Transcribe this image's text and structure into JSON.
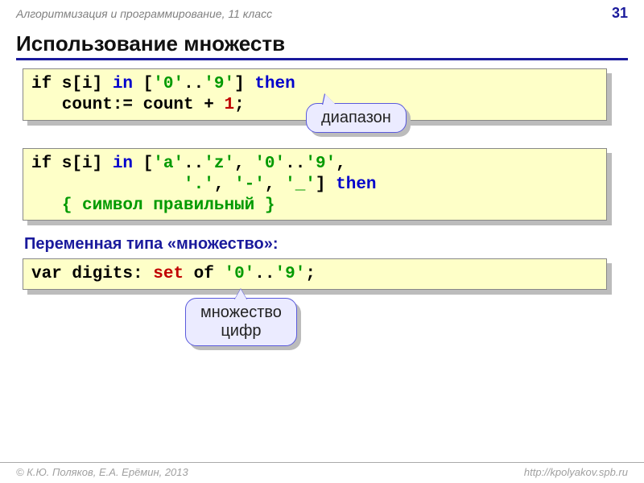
{
  "header": {
    "breadcrumb": "Алгоритмизация и программирование, 11 класс",
    "page": "31"
  },
  "title": "Использование множеств",
  "code1": {
    "l1_a": "if s[i] ",
    "l1_in": "in",
    "l1_b": " [",
    "l1_lit1": "'0'",
    "l1_c": "..",
    "l1_lit2": "'9'",
    "l1_d": "] ",
    "l1_then": "then",
    "l2_a": "   count:= count + ",
    "l2_one": "1",
    "l2_b": ";"
  },
  "callout1": "диапазон",
  "code2": {
    "l1_a": "if s[i] ",
    "l1_in": "in",
    "l1_b": " [",
    "l1_lit1": "'a'",
    "l1_c": "..",
    "l1_lit2": "'z'",
    "l1_d": ", ",
    "l1_lit3": "'0'",
    "l1_e": "..",
    "l1_lit4": "'9'",
    "l1_f": ",",
    "l2_pad": "               ",
    "l2_lit1": "'.'",
    "l2_a": ", ",
    "l2_lit2": "'-'",
    "l2_b": ", ",
    "l2_lit3": "'_'",
    "l2_c": "] ",
    "l2_then": "then",
    "l3_pad": "   ",
    "l3_cmt": "{ символ правильный }"
  },
  "subheading": "Переменная типа «множество»:",
  "code3": {
    "a": "var digits: ",
    "set": "set",
    "b": " of ",
    "lit1": "'0'",
    "c": "..",
    "lit2": "'9'",
    "d": ";"
  },
  "callout2": "множество\nцифр",
  "footer": {
    "left": "© К.Ю. Поляков, Е.А. Ерёмин, 2013",
    "right": "http://kpolyakov.spb.ru"
  }
}
